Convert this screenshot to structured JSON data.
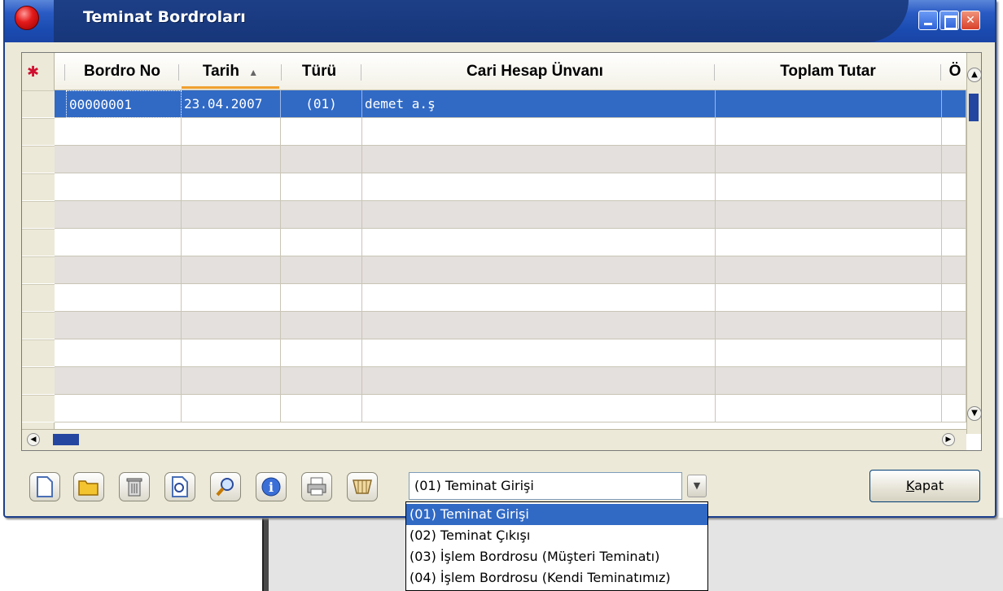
{
  "window": {
    "title": "Teminat Bordroları"
  },
  "grid": {
    "columns": [
      "Bordro No",
      "Tarih",
      "Türü",
      "Cari Hesap Ünvanı",
      "Toplam Tutar",
      "Ö"
    ],
    "sort_indicator": "▲",
    "rows": [
      {
        "bordro_no": "00000001",
        "tarih": "23.04.2007",
        "turu": "(01)",
        "cari_hesap_unvani": "demet a.ş",
        "toplam_tutar": ""
      }
    ]
  },
  "toolbar": {
    "icons": [
      "new-icon",
      "open-icon",
      "delete-icon",
      "preview-icon",
      "search-icon",
      "info-icon",
      "print-icon",
      "filter-icon"
    ],
    "type_select_value": "(01) Teminat Girişi",
    "close_label": "Kapat"
  },
  "dropdown": {
    "options": [
      "(01) Teminat Girişi",
      "(02) Teminat Çıkışı",
      "(03) İşlem Bordrosu (Müşteri Teminatı)",
      "(04) İşlem Bordrosu (Kendi Teminatımız)"
    ],
    "selected_index": 0
  },
  "colors": {
    "selection": "#316ac5",
    "titlebar": "#1a4bb0",
    "alt_row": "#e3e0dd"
  }
}
